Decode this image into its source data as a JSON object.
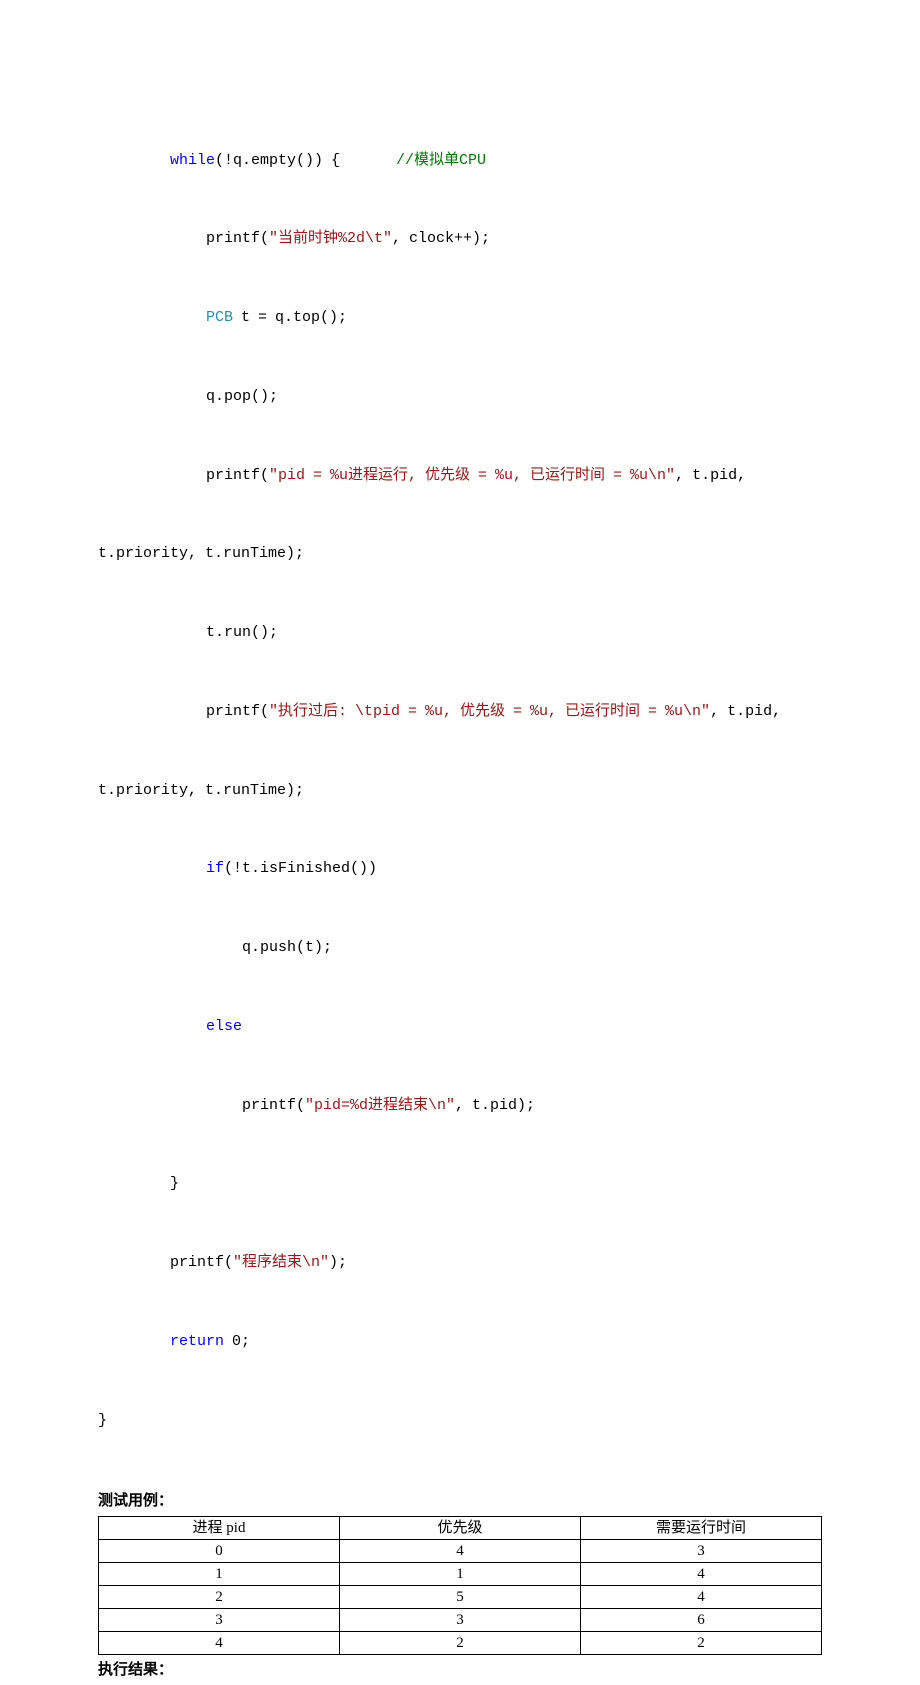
{
  "code": {
    "l1_kw": "while",
    "l1_rest": "(!q.empty()) {       ",
    "l1_comment": "//模拟单CPU",
    "l2_pre": "printf(",
    "l2_str": "\"当前时钟%2d\\t\"",
    "l2_post": ", clock++);",
    "l3_type": "PCB",
    "l3_rest": " t = q.top();",
    "l4": "q.pop();",
    "l5_pre": "printf(",
    "l5_str": "\"pid = %u进程运行, 优先级 = %u, 已运行时间 = %u\\n\"",
    "l5_post": ", t.pid, ",
    "l5_wrap": "t.priority, t.runTime);",
    "l6": "t.run();",
    "l7_pre": "printf(",
    "l7_str": "\"执行过后: \\tpid = %u, 优先级 = %u, 已运行时间 = %u\\n\"",
    "l7_post": ", t.pid, ",
    "l7_wrap": "t.priority, t.runTime);",
    "l8_kw": "if",
    "l8_rest": "(!t.isFinished())",
    "l9": "q.push(t);",
    "l10_kw": "else",
    "l11_pre": "printf(",
    "l11_str": "\"pid=%d进程结束\\n\"",
    "l11_post": ", t.pid);",
    "l12": "}",
    "l13_pre": "printf(",
    "l13_str": "\"程序结束\\n\"",
    "l13_post": ");",
    "l14_kw": "return",
    "l14_rest": " 0;",
    "l15": "}"
  },
  "labels": {
    "testcase": "测试用例：",
    "result": "执行结果："
  },
  "table": {
    "headers": [
      "进程 pid",
      "优先级",
      "需要运行时间"
    ],
    "rows": [
      [
        "0",
        "4",
        "3"
      ],
      [
        "1",
        "1",
        "4"
      ],
      [
        "2",
        "5",
        "4"
      ],
      [
        "3",
        "3",
        "6"
      ],
      [
        "4",
        "2",
        "2"
      ]
    ]
  }
}
